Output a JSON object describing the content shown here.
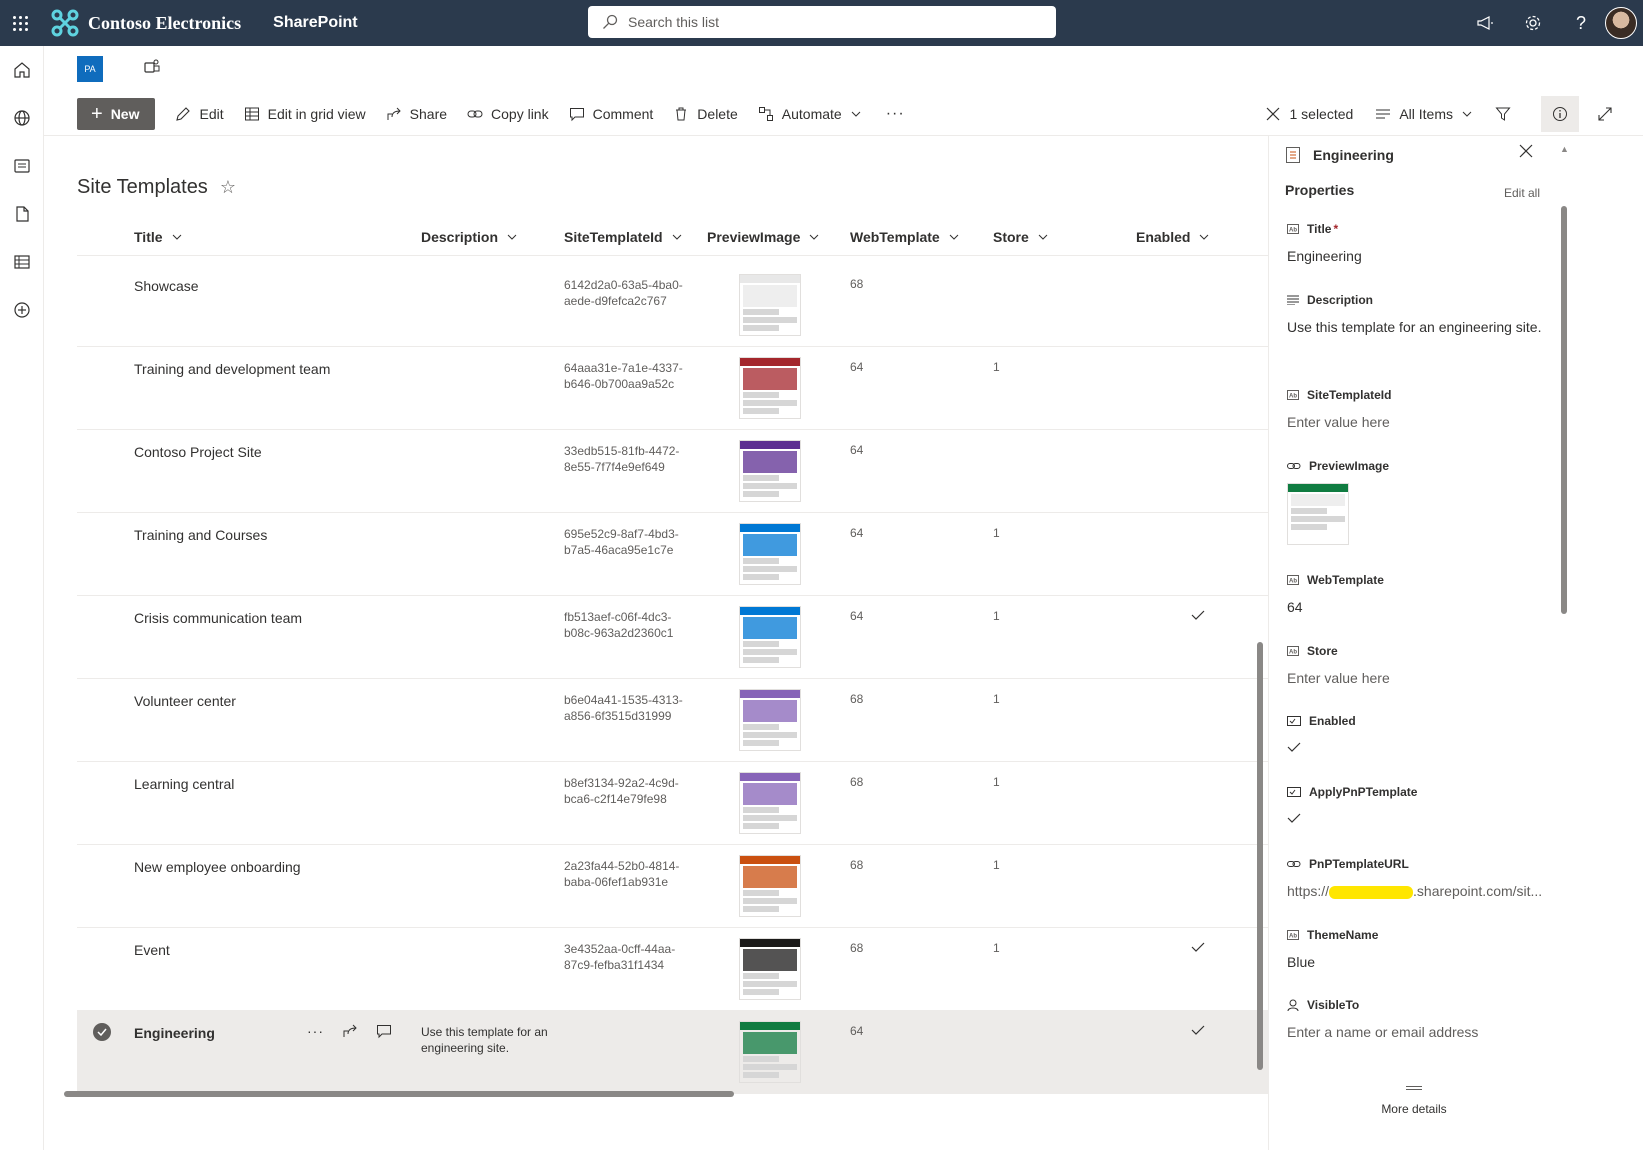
{
  "suite": {
    "brand": "Contoso Electronics",
    "app": "SharePoint",
    "search_placeholder": "Search this list"
  },
  "site": {
    "logo_text": "PA"
  },
  "commands": {
    "new": "New",
    "edit": "Edit",
    "grid": "Edit in grid view",
    "share": "Share",
    "copy_link": "Copy link",
    "comment": "Comment",
    "delete": "Delete",
    "automate": "Automate",
    "selected": "1 selected",
    "view": "All Items"
  },
  "list": {
    "title": "Site Templates",
    "columns": [
      "Title",
      "Description",
      "SiteTemplateId",
      "PreviewImage",
      "WebTemplate",
      "Store",
      "Enabled"
    ],
    "rows": [
      {
        "title": "Showcase",
        "description": "",
        "id_line1": "6142d2a0-63a5-4ba0-",
        "id_line2": "aede-d9fefca2c767",
        "web": "68",
        "store": "",
        "enabled": false,
        "thumb": "#e8e8e8"
      },
      {
        "title": "Training and development team",
        "description": "",
        "id_line1": "64aaa31e-7a1e-4337-",
        "id_line2": "b646-0b700aa9a52c",
        "web": "64",
        "store": "1",
        "enabled": false,
        "thumb": "#a4262c"
      },
      {
        "title": "Contoso Project Site",
        "description": "",
        "id_line1": "33edb515-81fb-4472-",
        "id_line2": "8e55-7f7f4e9ef649",
        "web": "64",
        "store": "",
        "enabled": false,
        "thumb": "#5c2d91"
      },
      {
        "title": "Training and Courses",
        "description": "",
        "id_line1": "695e52c9-8af7-4bd3-",
        "id_line2": "b7a5-46aca95e1c7e",
        "web": "64",
        "store": "1",
        "enabled": false,
        "thumb": "#0078d4"
      },
      {
        "title": "Crisis communication team",
        "description": "",
        "id_line1": "fb513aef-c06f-4dc3-",
        "id_line2": "b08c-963a2d2360c1",
        "web": "64",
        "store": "1",
        "enabled": true,
        "thumb": "#0078d4"
      },
      {
        "title": "Volunteer center",
        "description": "",
        "id_line1": "b6e04a41-1535-4313-",
        "id_line2": "a856-6f3515d31999",
        "web": "68",
        "store": "1",
        "enabled": false,
        "thumb": "#8764b8"
      },
      {
        "title": "Learning central",
        "description": "",
        "id_line1": "b8ef3134-92a2-4c9d-",
        "id_line2": "bca6-c2f14e79fe98",
        "web": "68",
        "store": "1",
        "enabled": false,
        "thumb": "#8764b8"
      },
      {
        "title": "New employee onboarding",
        "description": "",
        "id_line1": "2a23fa44-52b0-4814-",
        "id_line2": "baba-06fef1ab931e",
        "web": "68",
        "store": "1",
        "enabled": false,
        "thumb": "#ca5010"
      },
      {
        "title": "Event",
        "description": "",
        "id_line1": "3e4352aa-0cff-44aa-",
        "id_line2": "87c9-fefba31f1434",
        "web": "68",
        "store": "1",
        "enabled": true,
        "thumb": "#1b1a19"
      },
      {
        "title": "Engineering",
        "description": "Use this template for an engineering site.",
        "id_line1": "",
        "id_line2": "",
        "web": "64",
        "store": "",
        "enabled": true,
        "thumb": "#107c41",
        "selected": true
      }
    ]
  },
  "panel": {
    "title": "Engineering",
    "section": "Properties",
    "edit_all": "Edit all",
    "fields": {
      "title_label": "Title",
      "title_value": "Engineering",
      "desc_label": "Description",
      "desc_value": "Use this template for an engineering site.",
      "siteid_label": "SiteTemplateId",
      "siteid_value": "Enter value here",
      "preview_label": "PreviewImage",
      "web_label": "WebTemplate",
      "web_value": "64",
      "store_label": "Store",
      "store_value": "Enter value here",
      "enabled_label": "Enabled",
      "pnp_label": "ApplyPnPTemplate",
      "url_label": "PnPTemplateURL",
      "url_prefix": "https://",
      "url_suffix": ".sharepoint.com/sit...",
      "theme_label": "ThemeName",
      "theme_value": "Blue",
      "visible_label": "VisibleTo",
      "visible_value": "Enter a name or email address"
    },
    "more_details": "More details"
  },
  "colors": {
    "suite_bar": "#2b3a4d",
    "accent": "#0f6cbd"
  }
}
